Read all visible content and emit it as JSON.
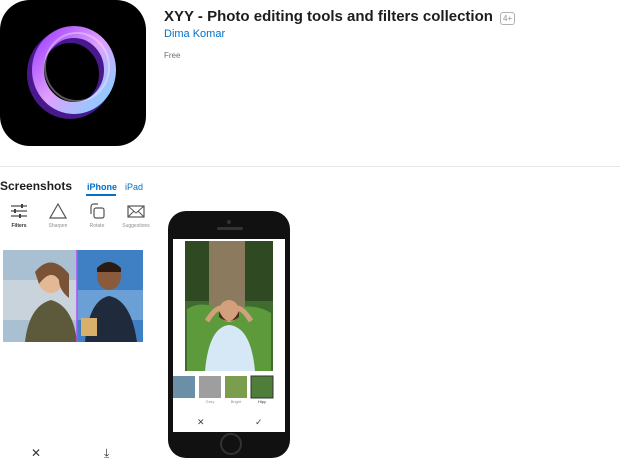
{
  "app": {
    "title": "XYY - Photo editing tools and filters collection",
    "age_rating": "4+",
    "developer": "Dima Komar",
    "price": "Free"
  },
  "screenshots": {
    "title": "Screenshots",
    "tabs": [
      {
        "label": "iPhone",
        "selected": true
      },
      {
        "label": "iPad",
        "selected": false
      }
    ]
  },
  "shot1": {
    "tools": [
      {
        "label": "Filters",
        "icon": "sliders-icon",
        "active": true
      },
      {
        "label": "Sharpen",
        "icon": "triangle-icon",
        "active": false
      },
      {
        "label": "Rotate",
        "icon": "rotate-icon",
        "active": false
      },
      {
        "label": "Suggestions",
        "icon": "envelope-icon",
        "active": false
      }
    ],
    "actions": [
      {
        "label": "✕",
        "icon": "close-icon"
      },
      {
        "label": "⤓",
        "icon": "download-icon"
      }
    ]
  },
  "shot2": {
    "filters": [
      "",
      "Grey",
      "Bright",
      "Hipy"
    ],
    "actions": [
      {
        "label": "✕",
        "icon": "close-icon"
      },
      {
        "label": "✓",
        "icon": "check-icon"
      }
    ]
  },
  "colors": {
    "accent": "#0070c9",
    "text": "#1d1d1f",
    "secondary": "#8e8e93"
  }
}
